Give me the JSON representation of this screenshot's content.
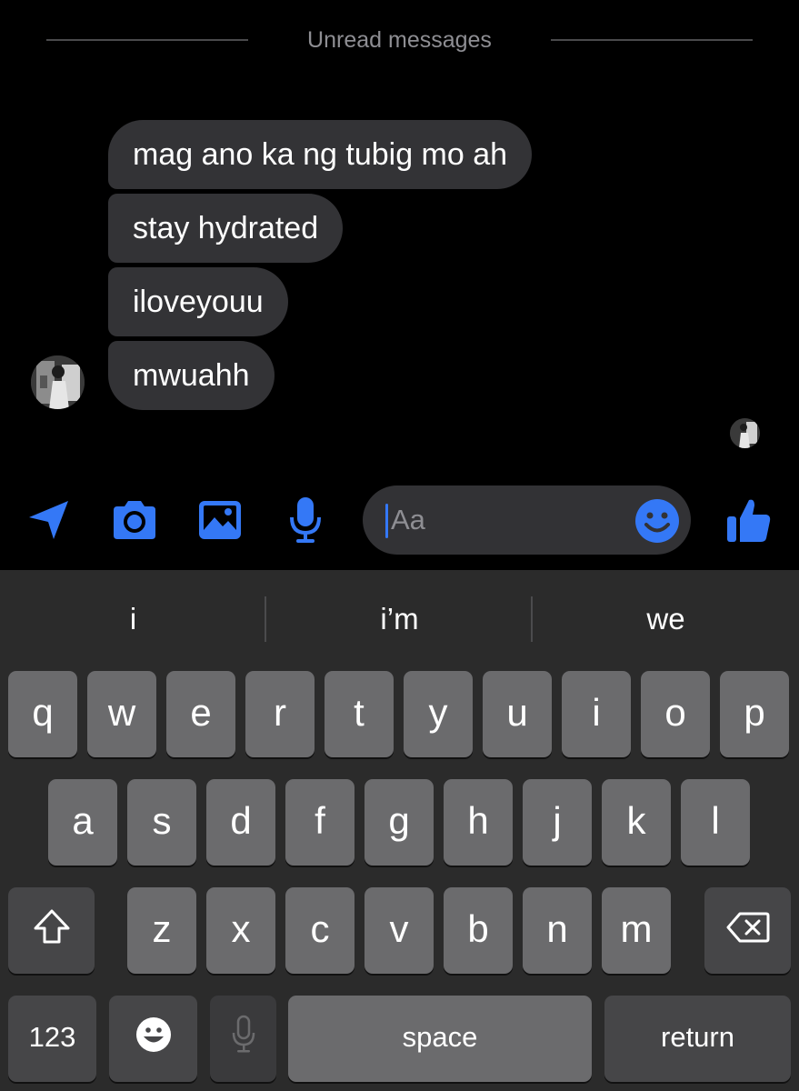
{
  "divider": {
    "label": "Unread messages"
  },
  "messages": [
    {
      "text": "mag ano ka ng tubig mo ah"
    },
    {
      "text": "stay hydrated"
    },
    {
      "text": "iloveyouu"
    },
    {
      "text": "mwuahh"
    }
  ],
  "composer": {
    "placeholder": "Aa",
    "tools": [
      "location-icon",
      "camera-icon",
      "image-icon",
      "microphone-icon"
    ],
    "accent": "#3478f6"
  },
  "keyboard": {
    "suggestions": [
      "i",
      "i’m",
      "we"
    ],
    "row1": [
      "q",
      "w",
      "e",
      "r",
      "t",
      "y",
      "u",
      "i",
      "o",
      "p"
    ],
    "row2": [
      "a",
      "s",
      "d",
      "f",
      "g",
      "h",
      "j",
      "k",
      "l"
    ],
    "row3": [
      "z",
      "x",
      "c",
      "v",
      "b",
      "n",
      "m"
    ],
    "numbers_label": "123",
    "space_label": "space",
    "return_label": "return"
  }
}
